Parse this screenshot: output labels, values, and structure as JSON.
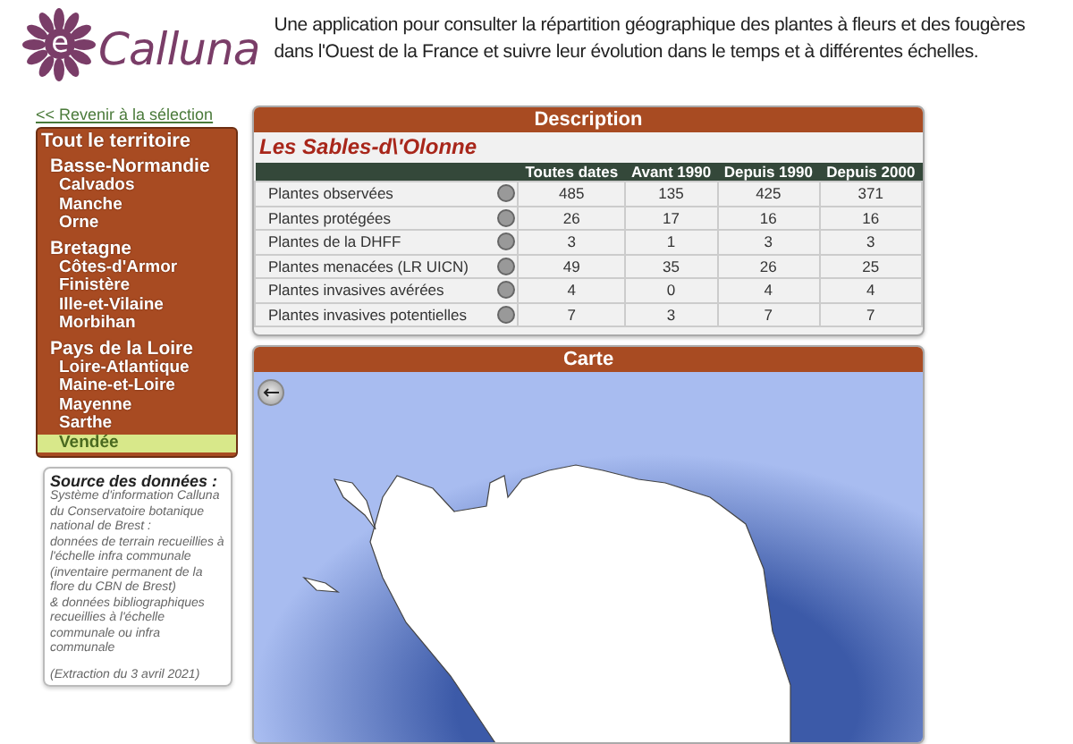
{
  "header": {
    "logo": {
      "mark": "e",
      "name": "Calluna"
    },
    "tagline": "Une application pour consulter la répartition géographique des plantes à fleurs et des fougères dans l'Ouest de la France et suivre leur évolution dans le temps et à différentes échelles."
  },
  "sidebar": {
    "back_link": "<< Revenir à la sélection",
    "tree": [
      {
        "label": "Tout le territoire",
        "selected": false,
        "children": [
          {
            "label": "Basse-Normandie",
            "selected": false,
            "children": [
              {
                "label": "Calvados",
                "selected": false
              },
              {
                "label": "Manche",
                "selected": false
              },
              {
                "label": "Orne",
                "selected": false
              }
            ]
          },
          {
            "label": "Bretagne",
            "selected": false,
            "children": [
              {
                "label": "Côtes-d'Armor",
                "selected": false
              },
              {
                "label": "Finistère",
                "selected": false
              },
              {
                "label": "Ille-et-Vilaine",
                "selected": false
              },
              {
                "label": "Morbihan",
                "selected": false
              }
            ]
          },
          {
            "label": "Pays de la Loire",
            "selected": false,
            "children": [
              {
                "label": "Loire-Atlantique",
                "selected": false
              },
              {
                "label": "Maine-et-Loire",
                "selected": false
              },
              {
                "label": "Mayenne",
                "selected": false
              },
              {
                "label": "Sarthe",
                "selected": false
              },
              {
                "label": "Vendée",
                "selected": true
              }
            ]
          }
        ]
      }
    ],
    "source": {
      "title": "Source des données :",
      "paragraphs": [
        "Système d'information Calluna du Conservatoire botanique national de Brest :",
        "données de terrain recueillies à l'échelle infra communale (inventaire permanent de la flore du CBN de Brest)",
        "& données bibliographiques recueillies à l'échelle communale ou infra communale"
      ],
      "extraction": "(Extraction du 3 avril 2021)"
    }
  },
  "description": {
    "title": "Description",
    "place": "Les Sables-d\\'Olonne",
    "columns": [
      "Toutes dates",
      "Avant 1990",
      "Depuis 1990",
      "Depuis 2000"
    ],
    "rows": [
      {
        "label": "Plantes observées",
        "values": [
          "485",
          "135",
          "425",
          "371"
        ]
      },
      {
        "label": "Plantes protégées",
        "values": [
          "26",
          "17",
          "16",
          "16"
        ]
      },
      {
        "label": "Plantes de la DHFF",
        "values": [
          "3",
          "1",
          "3",
          "3"
        ]
      },
      {
        "label": "Plantes menacées (LR UICN)",
        "values": [
          "49",
          "35",
          "26",
          "25"
        ]
      },
      {
        "label": "Plantes invasives avérées",
        "values": [
          "4",
          "0",
          "4",
          "4"
        ]
      },
      {
        "label": "Plantes invasives potentielles",
        "values": [
          "7",
          "3",
          "7",
          "7"
        ]
      }
    ]
  },
  "map": {
    "title": "Carte"
  }
}
